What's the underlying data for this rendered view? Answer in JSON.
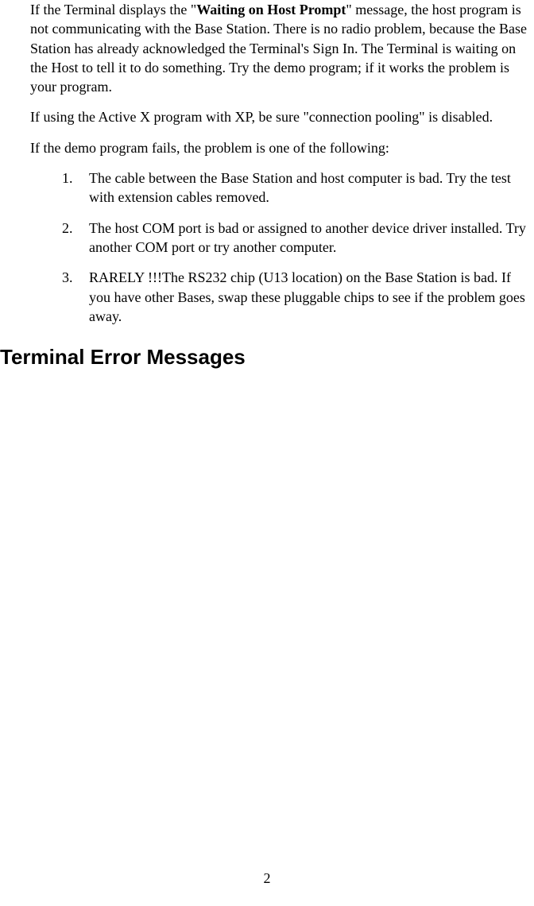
{
  "para1_pre": "If the Terminal displays the \"",
  "para1_bold": "Waiting on Host Prompt",
  "para1_post": "\" message, the host program is not communicating with the Base Station. There is no radio problem, because the Base Station has already acknowledged the Terminal's Sign In. The Terminal is waiting on the Host to tell it to do something.  Try the demo program; if it works the problem is your program.",
  "para2": "If using the Active X program with XP, be sure \"connection pooling\" is disabled.",
  "para3": "If the demo program fails, the problem is one of the following:",
  "list": [
    {
      "num": "1.",
      "text": "The cable between the Base Station and host computer is bad. Try the test with extension cables removed."
    },
    {
      "num": "2.",
      "text": "The host COM port is bad or assigned to another device driver installed.  Try another COM port or try another computer."
    },
    {
      "num": "3.",
      "text": "RARELY !!!The RS232 chip (U13 location) on the Base Station is bad. If you have other Bases, swap these pluggable chips to see if the problem goes away."
    }
  ],
  "heading": "Terminal Error Messages",
  "page_number": "2"
}
